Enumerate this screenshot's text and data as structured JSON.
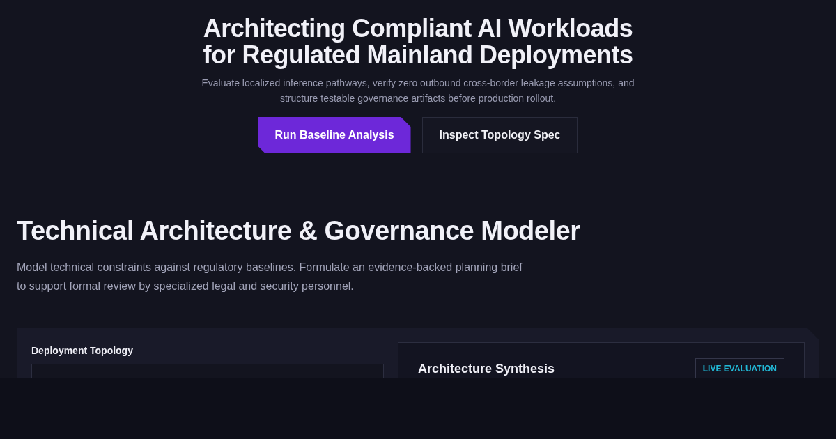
{
  "hero": {
    "title_lines": [
      "Architecting Compliant AI Workloads",
      "for Regulated Mainland Deployments"
    ],
    "subtitle": "Evaluate localized inference pathways, verify zero outbound cross-border leakage assumptions, and structure testable governance artifacts before production rollout.",
    "buttons": [
      {
        "label": "Run Baseline Analysis",
        "kind": "primary"
      },
      {
        "label": "Inspect Topology Spec",
        "kind": "secondary"
      }
    ]
  },
  "section": {
    "title": "Technical Architecture & Governance Modeler",
    "description": "Model technical constraints against regulatory baselines. Formulate an evidence-backed planning brief to support formal review by specialized legal and security personnel."
  },
  "modeler": {
    "field_label": "Deployment Topology",
    "panel_title": "Architecture Synthesis",
    "badge": "LIVE EVALUATION"
  }
}
